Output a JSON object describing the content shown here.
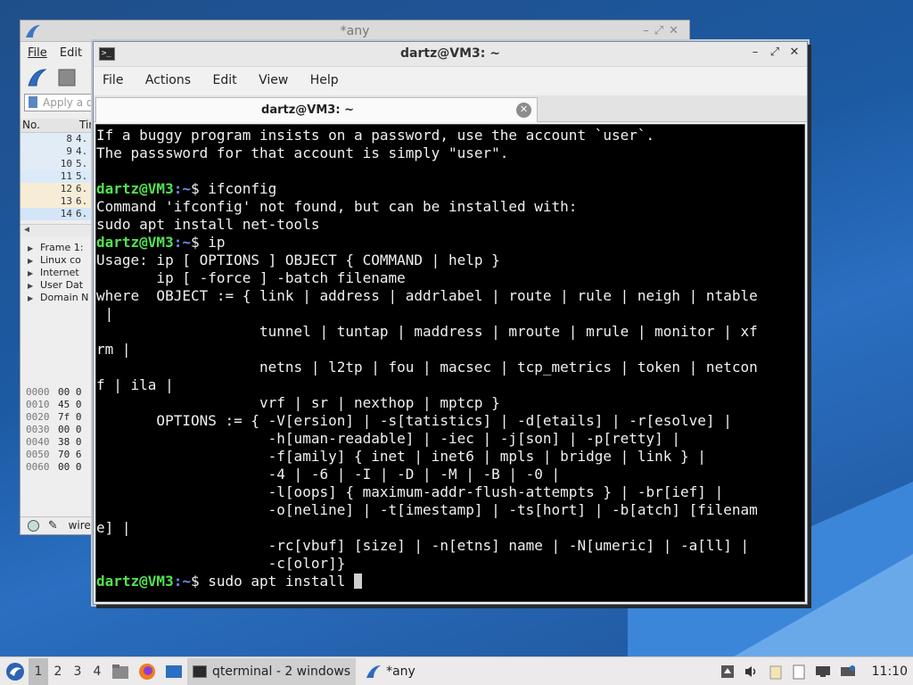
{
  "wireshark": {
    "title": "*any",
    "menu": [
      "File",
      "Edit"
    ],
    "filter_placeholder": "Apply a d",
    "list_headers": [
      "No.",
      "Tir"
    ],
    "rows": [
      {
        "no": "8",
        "t": "4.",
        "bg": "#e1ecf7"
      },
      {
        "no": "9",
        "t": "4.",
        "bg": "#e1ecf7"
      },
      {
        "no": "10",
        "t": "5.",
        "bg": "#e1ecf7"
      },
      {
        "no": "11",
        "t": "5.",
        "bg": "#daeaf9"
      },
      {
        "no": "12",
        "t": "6.",
        "bg": "#f7edd6"
      },
      {
        "no": "13",
        "t": "6.",
        "bg": "#f7edd6"
      },
      {
        "no": "14",
        "t": "6.",
        "bg": "#d4e5f8"
      }
    ],
    "details": [
      "Frame 1:",
      "Linux co",
      "Internet",
      "User Dat",
      "Domain N"
    ],
    "hex": [
      {
        "off": "0000",
        "b": "00 0"
      },
      {
        "off": "0010",
        "b": "45 0"
      },
      {
        "off": "0020",
        "b": "7f 0"
      },
      {
        "off": "0030",
        "b": "00 0"
      },
      {
        "off": "0040",
        "b": "38 0"
      },
      {
        "off": "0050",
        "b": "70 6"
      },
      {
        "off": "0060",
        "b": "00 0"
      }
    ],
    "status_text": "wire"
  },
  "terminal": {
    "title": "dartz@VM3: ~",
    "menu": [
      "File",
      "Actions",
      "Edit",
      "View",
      "Help"
    ],
    "tab_label": "dartz@VM3: ~",
    "prompt_user": "dartz@VM3",
    "prompt_path": ":~",
    "prompt_sym": "$ ",
    "lines": [
      {
        "type": "out",
        "text": "If a buggy program insists on a password, use the account `user`."
      },
      {
        "type": "out",
        "text": "The passsword for that account is simply \"user\"."
      },
      {
        "type": "out",
        "text": ""
      },
      {
        "type": "cmd",
        "text": "ifconfig"
      },
      {
        "type": "out",
        "text": "Command 'ifconfig' not found, but can be installed with:"
      },
      {
        "type": "out",
        "text": "sudo apt install net-tools"
      },
      {
        "type": "cmd",
        "text": "ip"
      },
      {
        "type": "out",
        "text": "Usage: ip [ OPTIONS ] OBJECT { COMMAND | help }"
      },
      {
        "type": "out",
        "text": "       ip [ -force ] -batch filename"
      },
      {
        "type": "out",
        "text": "where  OBJECT := { link | address | addrlabel | route | rule | neigh | ntable"
      },
      {
        "type": "out",
        "text": " |"
      },
      {
        "type": "out",
        "text": "                   tunnel | tuntap | maddress | mroute | mrule | monitor | xf"
      },
      {
        "type": "out",
        "text": "rm |"
      },
      {
        "type": "out",
        "text": "                   netns | l2tp | fou | macsec | tcp_metrics | token | netcon"
      },
      {
        "type": "out",
        "text": "f | ila |"
      },
      {
        "type": "out",
        "text": "                   vrf | sr | nexthop | mptcp }"
      },
      {
        "type": "out",
        "text": "       OPTIONS := { -V[ersion] | -s[tatistics] | -d[etails] | -r[esolve] |"
      },
      {
        "type": "out",
        "text": "                    -h[uman-readable] | -iec | -j[son] | -p[retty] |"
      },
      {
        "type": "out",
        "text": "                    -f[amily] { inet | inet6 | mpls | bridge | link } |"
      },
      {
        "type": "out",
        "text": "                    -4 | -6 | -I | -D | -M | -B | -0 |"
      },
      {
        "type": "out",
        "text": "                    -l[oops] { maximum-addr-flush-attempts } | -br[ief] |"
      },
      {
        "type": "out",
        "text": "                    -o[neline] | -t[imestamp] | -ts[hort] | -b[atch] [filenam"
      },
      {
        "type": "out",
        "text": "e] |"
      },
      {
        "type": "out",
        "text": "                    -rc[vbuf] [size] | -n[etns] name | -N[umeric] | -a[ll] |"
      },
      {
        "type": "out",
        "text": "                    -c[olor]}"
      },
      {
        "type": "cmd",
        "text": "sudo apt install "
      }
    ]
  },
  "taskbar": {
    "desktops": [
      "1",
      "2",
      "3",
      "4"
    ],
    "active_desktop": "1",
    "tasks": [
      {
        "label": "qterminal - 2 windows",
        "icon": "terminal-icon",
        "active": true
      },
      {
        "label": "*any",
        "icon": "wireshark-icon",
        "active": false
      }
    ],
    "clock": "11:10"
  }
}
